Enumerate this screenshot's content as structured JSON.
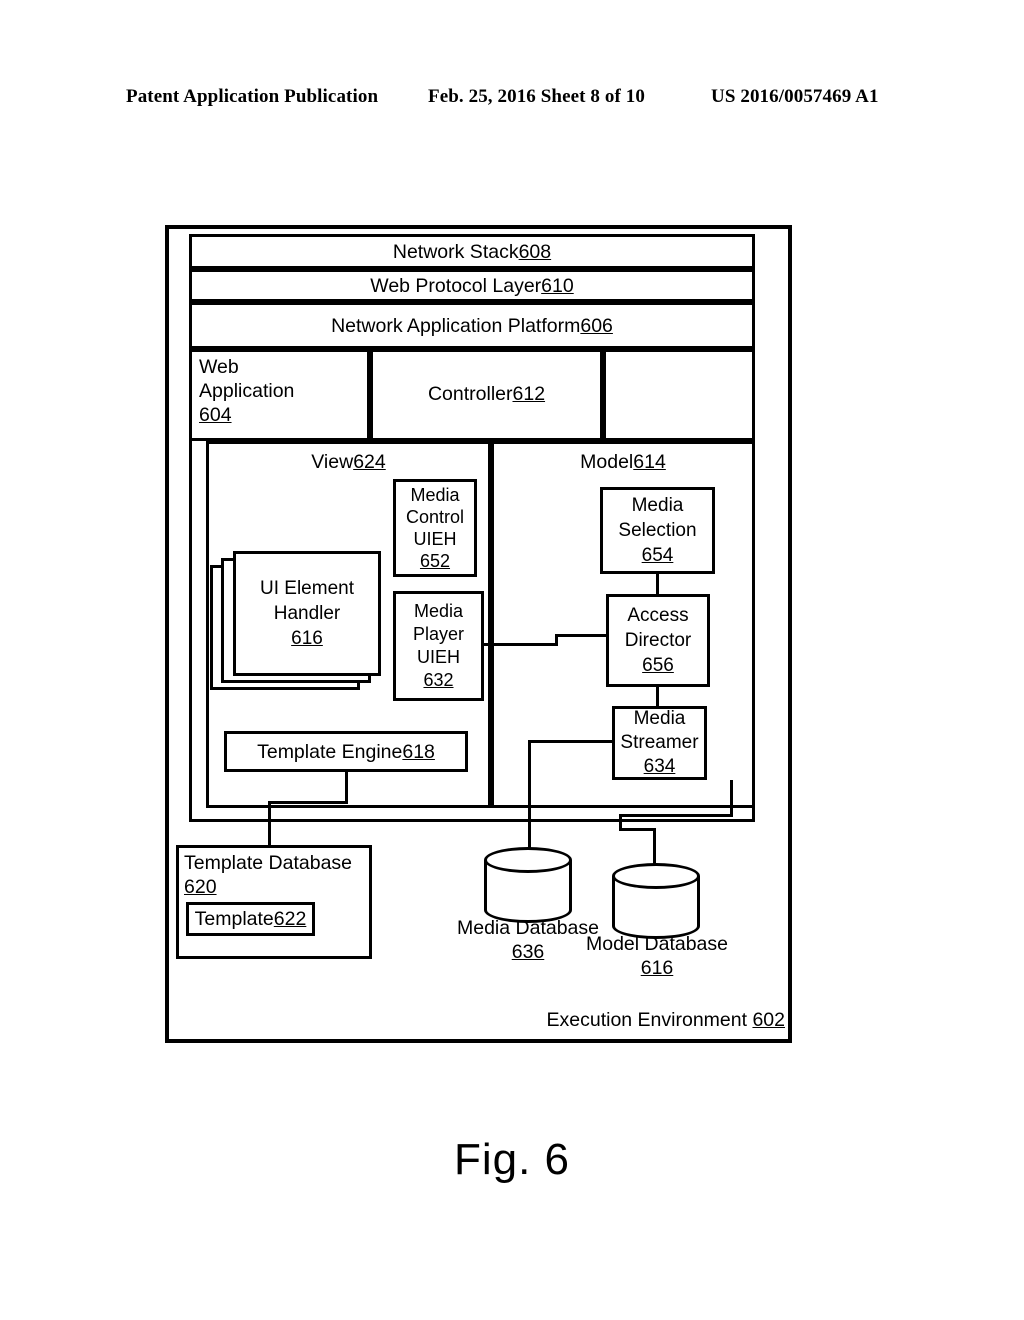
{
  "header": {
    "left": "Patent Application Publication",
    "middle": "Feb. 25, 2016  Sheet 8 of 10",
    "right": "US 2016/0057469 A1"
  },
  "figure": {
    "caption": "Fig. 6"
  },
  "diagram": {
    "exec_environment": {
      "label": "Execution Environment ",
      "ref": "602"
    },
    "network_stack": {
      "label": "Network Stack ",
      "ref": "608"
    },
    "web_protocol_layer": {
      "label": "Web Protocol Layer ",
      "ref": "610"
    },
    "network_application_platform": {
      "label": "Network Application Platform ",
      "ref": "606"
    },
    "web_application": {
      "label": "Web\nApplication\n",
      "ref": "604"
    },
    "controller": {
      "label": "Controller ",
      "ref": "612"
    },
    "view": {
      "label": "View ",
      "ref": "624"
    },
    "model": {
      "label": "Model ",
      "ref": "614"
    },
    "media_control_uieh": {
      "label": "Media\nControl\nUIEH\n",
      "ref": "652"
    },
    "media_player_uieh": {
      "label": "Media\nPlayer\nUIEH\n",
      "ref": "632"
    },
    "ui_element_handler": {
      "label": "UI Element\nHandler\n",
      "ref": "616"
    },
    "template_engine": {
      "label": "Template Engine ",
      "ref": "618"
    },
    "media_selection": {
      "label": "Media\nSelection\n",
      "ref": "654"
    },
    "access_director": {
      "label": "Access\nDirector\n",
      "ref": "656"
    },
    "media_streamer": {
      "label": "Media\nStreamer\n",
      "ref": "634"
    },
    "template_database": {
      "label": "Template Database\n",
      "ref": "620"
    },
    "template": {
      "label": "Template ",
      "ref": "622"
    },
    "media_database": {
      "label": "Media Database\n",
      "ref": "636"
    },
    "model_database": {
      "label": "Model Database\n",
      "ref": "616"
    }
  }
}
